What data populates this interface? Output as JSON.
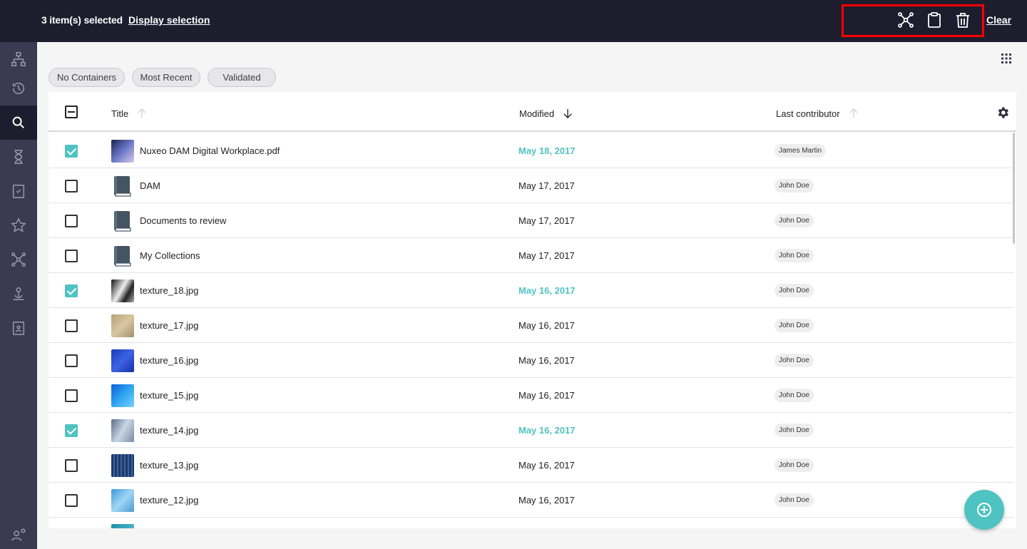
{
  "selection_bar": {
    "count_text": "3 item(s) selected",
    "display_selection": "Display selection",
    "clear": "Clear",
    "actions": [
      "add-to-collection-icon",
      "clipboard-icon",
      "trash-icon"
    ]
  },
  "sidebar": {
    "items": [
      "browse-icon",
      "history-icon",
      "search-icon",
      "tasks-hourglass-icon",
      "clipboard-check-icon",
      "star-icon",
      "collections-icon",
      "personal-workspace-icon",
      "worklist-icon"
    ],
    "active": "search-icon",
    "bottom": "user-settings-icon"
  },
  "filters": [
    "No Containers",
    "Most Recent",
    "Validated"
  ],
  "table": {
    "headers": {
      "title": "Title",
      "modified": "Modified",
      "contributor": "Last contributor"
    },
    "rows": [
      {
        "title": "Nuxeo DAM Digital Workplace.pdf",
        "modified": "May 18, 2017",
        "contributor": "James Martin",
        "selected": true
      },
      {
        "title": "DAM",
        "modified": "May 17, 2017",
        "contributor": "John Doe",
        "selected": false
      },
      {
        "title": "Documents to review",
        "modified": "May 17, 2017",
        "contributor": "John Doe",
        "selected": false
      },
      {
        "title": "My Collections",
        "modified": "May 17, 2017",
        "contributor": "John Doe",
        "selected": false
      },
      {
        "title": "texture_18.jpg",
        "modified": "May 16, 2017",
        "contributor": "John Doe",
        "selected": true
      },
      {
        "title": "texture_17.jpg",
        "modified": "May 16, 2017",
        "contributor": "John Doe",
        "selected": false
      },
      {
        "title": "texture_16.jpg",
        "modified": "May 16, 2017",
        "contributor": "John Doe",
        "selected": false
      },
      {
        "title": "texture_15.jpg",
        "modified": "May 16, 2017",
        "contributor": "John Doe",
        "selected": false
      },
      {
        "title": "texture_14.jpg",
        "modified": "May 16, 2017",
        "contributor": "John Doe",
        "selected": true
      },
      {
        "title": "texture_13.jpg",
        "modified": "May 16, 2017",
        "contributor": "John Doe",
        "selected": false
      },
      {
        "title": "texture_12.jpg",
        "modified": "May 16, 2017",
        "contributor": "John Doe",
        "selected": false
      }
    ]
  },
  "colors": {
    "topbar": "#1e1d2e",
    "sidebar": "#3a3a52",
    "accent": "#4fc3c1",
    "highlight": "#ff0000"
  },
  "fab_icon": "add-circle-icon"
}
